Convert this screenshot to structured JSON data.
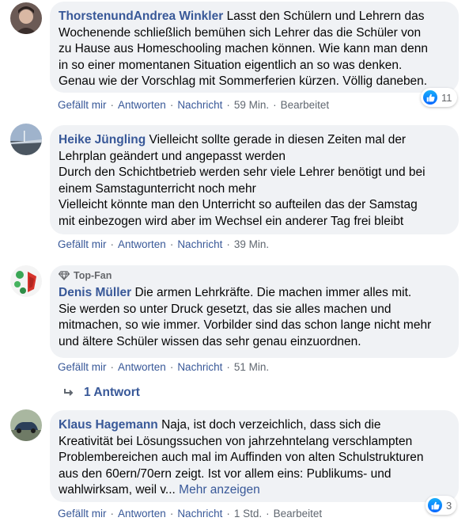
{
  "comments": [
    {
      "author": "ThorstenundAndrea Winkler",
      "text": " Lasst den Schülern und Lehrern das\nWochenende schließlich bemühen sich Lehrer das die Schüler von\nzu Hause aus Homeschooling machen können. Wie kann man denn\nin so einer momentanen Situation eigentlich an so was denken.\nGenau wie der Vorschlag mit Sommerferien kürzen. Völlig daneben.",
      "actions": {
        "like": "Gefällt mir",
        "reply": "Antworten",
        "message": "Nachricht",
        "time": "59 Min.",
        "edit": "Bearbeitet"
      },
      "reactions": "11"
    },
    {
      "author": "Heike Jüngling",
      "text": " Vielleicht sollte gerade in diesen Zeiten mal der\nLehrplan geändert und angepasst werden\nDurch den Schichtbetrieb werden sehr viele Lehrer benötigt und bei\neinem Samstagunterricht noch mehr\nVielleicht könnte man den Unterricht so aufteilen das der Samstag\nmit einbezogen wird aber im Wechsel ein anderer Tag frei bleibt",
      "actions": {
        "like": "Gefällt mir",
        "reply": "Antworten",
        "message": "Nachricht",
        "time": "39 Min."
      }
    },
    {
      "badge": "Top-Fan",
      "author": "Denis Müller",
      "text": " Die armen Lehrkräfte. Die machen immer alles mit.\nSie werden so unter Druck gesetzt, das sie alles machen und\nmitmachen, so wie immer. Vorbilder sind das schon lange nicht mehr\nund ältere Schüler wissen das sehr genau einzuordnen.",
      "actions": {
        "like": "Gefällt mir",
        "reply": "Antworten",
        "message": "Nachricht",
        "time": "51 Min."
      },
      "replies": "1 Antwort"
    },
    {
      "author": "Klaus Hagemann",
      "text": " Naja, ist doch verzeichlich, dass sich die\nKreativität bei Lösungssuchen von jahrzehntelang verschlampten\nProblembereichen auch mal im Auffinden von alten Schulstrukturen\naus den 60ern/70ern zeigt. Ist vor allem eins: Publikums- und\nwahlwirksam, weil v...",
      "more": " Mehr anzeigen",
      "actions": {
        "like": "Gefällt mir",
        "reply": "Antworten",
        "message": "Nachricht",
        "time": "1 Std.",
        "edit": "Bearbeitet"
      },
      "reactions": "3"
    }
  ],
  "colors": {
    "link": "#385898",
    "bubble": "#f0f2f5",
    "meta": "#606770"
  }
}
